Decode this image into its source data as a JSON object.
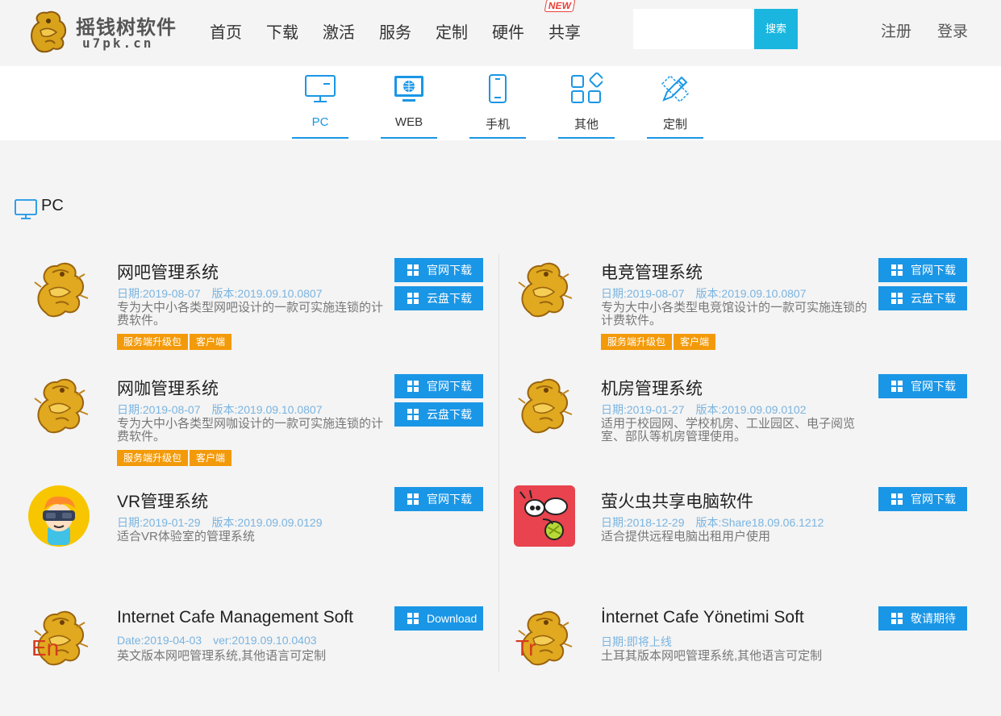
{
  "header": {
    "logo_text": "摇钱树软件",
    "logo_sub": "u7pk.cn",
    "nav": [
      "首页",
      "下载",
      "激活",
      "服务",
      "定制",
      "硬件",
      "共享"
    ],
    "new_badge": "NEW",
    "search_placeholder": "",
    "search_button": "搜索",
    "register": "注册",
    "login": "登录"
  },
  "tabs": [
    {
      "label": "PC",
      "icon": "monitor-icon",
      "active": true
    },
    {
      "label": "WEB",
      "icon": "web-monitor-icon",
      "active": false
    },
    {
      "label": "手机",
      "icon": "phone-icon",
      "active": false
    },
    {
      "label": "其他",
      "icon": "grid-icon",
      "active": false
    },
    {
      "label": "定制",
      "icon": "pencil-ruler-icon",
      "active": false
    }
  ],
  "section": {
    "title": "PC",
    "icon": "monitor-icon"
  },
  "products": [
    {
      "name": "网吧管理系统",
      "date": "日期:2019-08-07",
      "version": "版本:2019.09.10.0807",
      "desc": "专为大中小各类型网吧设计的一款可实施连锁的计费软件。",
      "tags": [
        "服务端升级包",
        "客户端"
      ],
      "buttons": [
        "官网下载",
        "云盘下载"
      ],
      "icon": "golden-dragon-icon",
      "icon_overlay": ""
    },
    {
      "name": "电竞管理系统",
      "date": "日期:2019-08-07",
      "version": "版本:2019.09.10.0807",
      "desc": "专为大中小各类型电竞馆设计的一款可实施连锁的计费软件。",
      "tags": [
        "服务端升级包",
        "客户端"
      ],
      "buttons": [
        "官网下载",
        "云盘下载"
      ],
      "icon": "golden-dragon-icon",
      "icon_overlay": ""
    },
    {
      "name": "网咖管理系统",
      "date": "日期:2019-08-07",
      "version": "版本:2019.09.10.0807",
      "desc": "专为大中小各类型网咖设计的一款可实施连锁的计费软件。",
      "tags": [
        "服务端升级包",
        "客户端"
      ],
      "buttons": [
        "官网下载",
        "云盘下载"
      ],
      "icon": "golden-dragon-icon",
      "icon_overlay": ""
    },
    {
      "name": "机房管理系统",
      "date": "日期:2019-01-27",
      "version": "版本:2019.09.09.0102",
      "desc": "适用于校园网、学校机房、工业园区、电子阅览室、部队等机房管理使用。",
      "tags": [],
      "buttons": [
        "官网下载"
      ],
      "icon": "golden-dragon-icon",
      "icon_overlay": ""
    },
    {
      "name": "VR管理系统",
      "date": "日期:2019-01-29",
      "version": "版本:2019.09.09.0129",
      "desc": "适合VR体验室的管理系统",
      "tags": [],
      "buttons": [
        "官网下载"
      ],
      "icon": "vr-headset-boy-icon",
      "icon_overlay": ""
    },
    {
      "name": "萤火虫共享电脑软件",
      "date": "日期:2018-12-29",
      "version": "版本:Share18.09.06.1212",
      "desc": "适合提供远程电脑出租用户使用",
      "tags": [],
      "buttons": [
        "官网下载"
      ],
      "icon": "firefly-icon",
      "icon_overlay": ""
    },
    {
      "name": "Internet Cafe Management Soft",
      "date": "Date:2019-04-03",
      "version": "ver:2019.09.10.0403",
      "desc": "英文版本网吧管理系统,其他语言可定制",
      "tags": [],
      "buttons": [
        "Download"
      ],
      "icon": "golden-dragon-icon",
      "icon_overlay": "En"
    },
    {
      "name": "İnternet Cafe Yönetimi Soft",
      "date": "日期:即将上线",
      "version": "",
      "desc": "土耳其版本网吧管理系统,其他语言可定制",
      "tags": [],
      "buttons": [
        "敬请期待"
      ],
      "icon": "golden-dragon-icon",
      "icon_overlay": "Tr"
    }
  ],
  "colors": {
    "accent": "#1a96e6",
    "search": "#1ab6e0",
    "tag": "#f39a0a",
    "meta": "#7ab4e0"
  }
}
